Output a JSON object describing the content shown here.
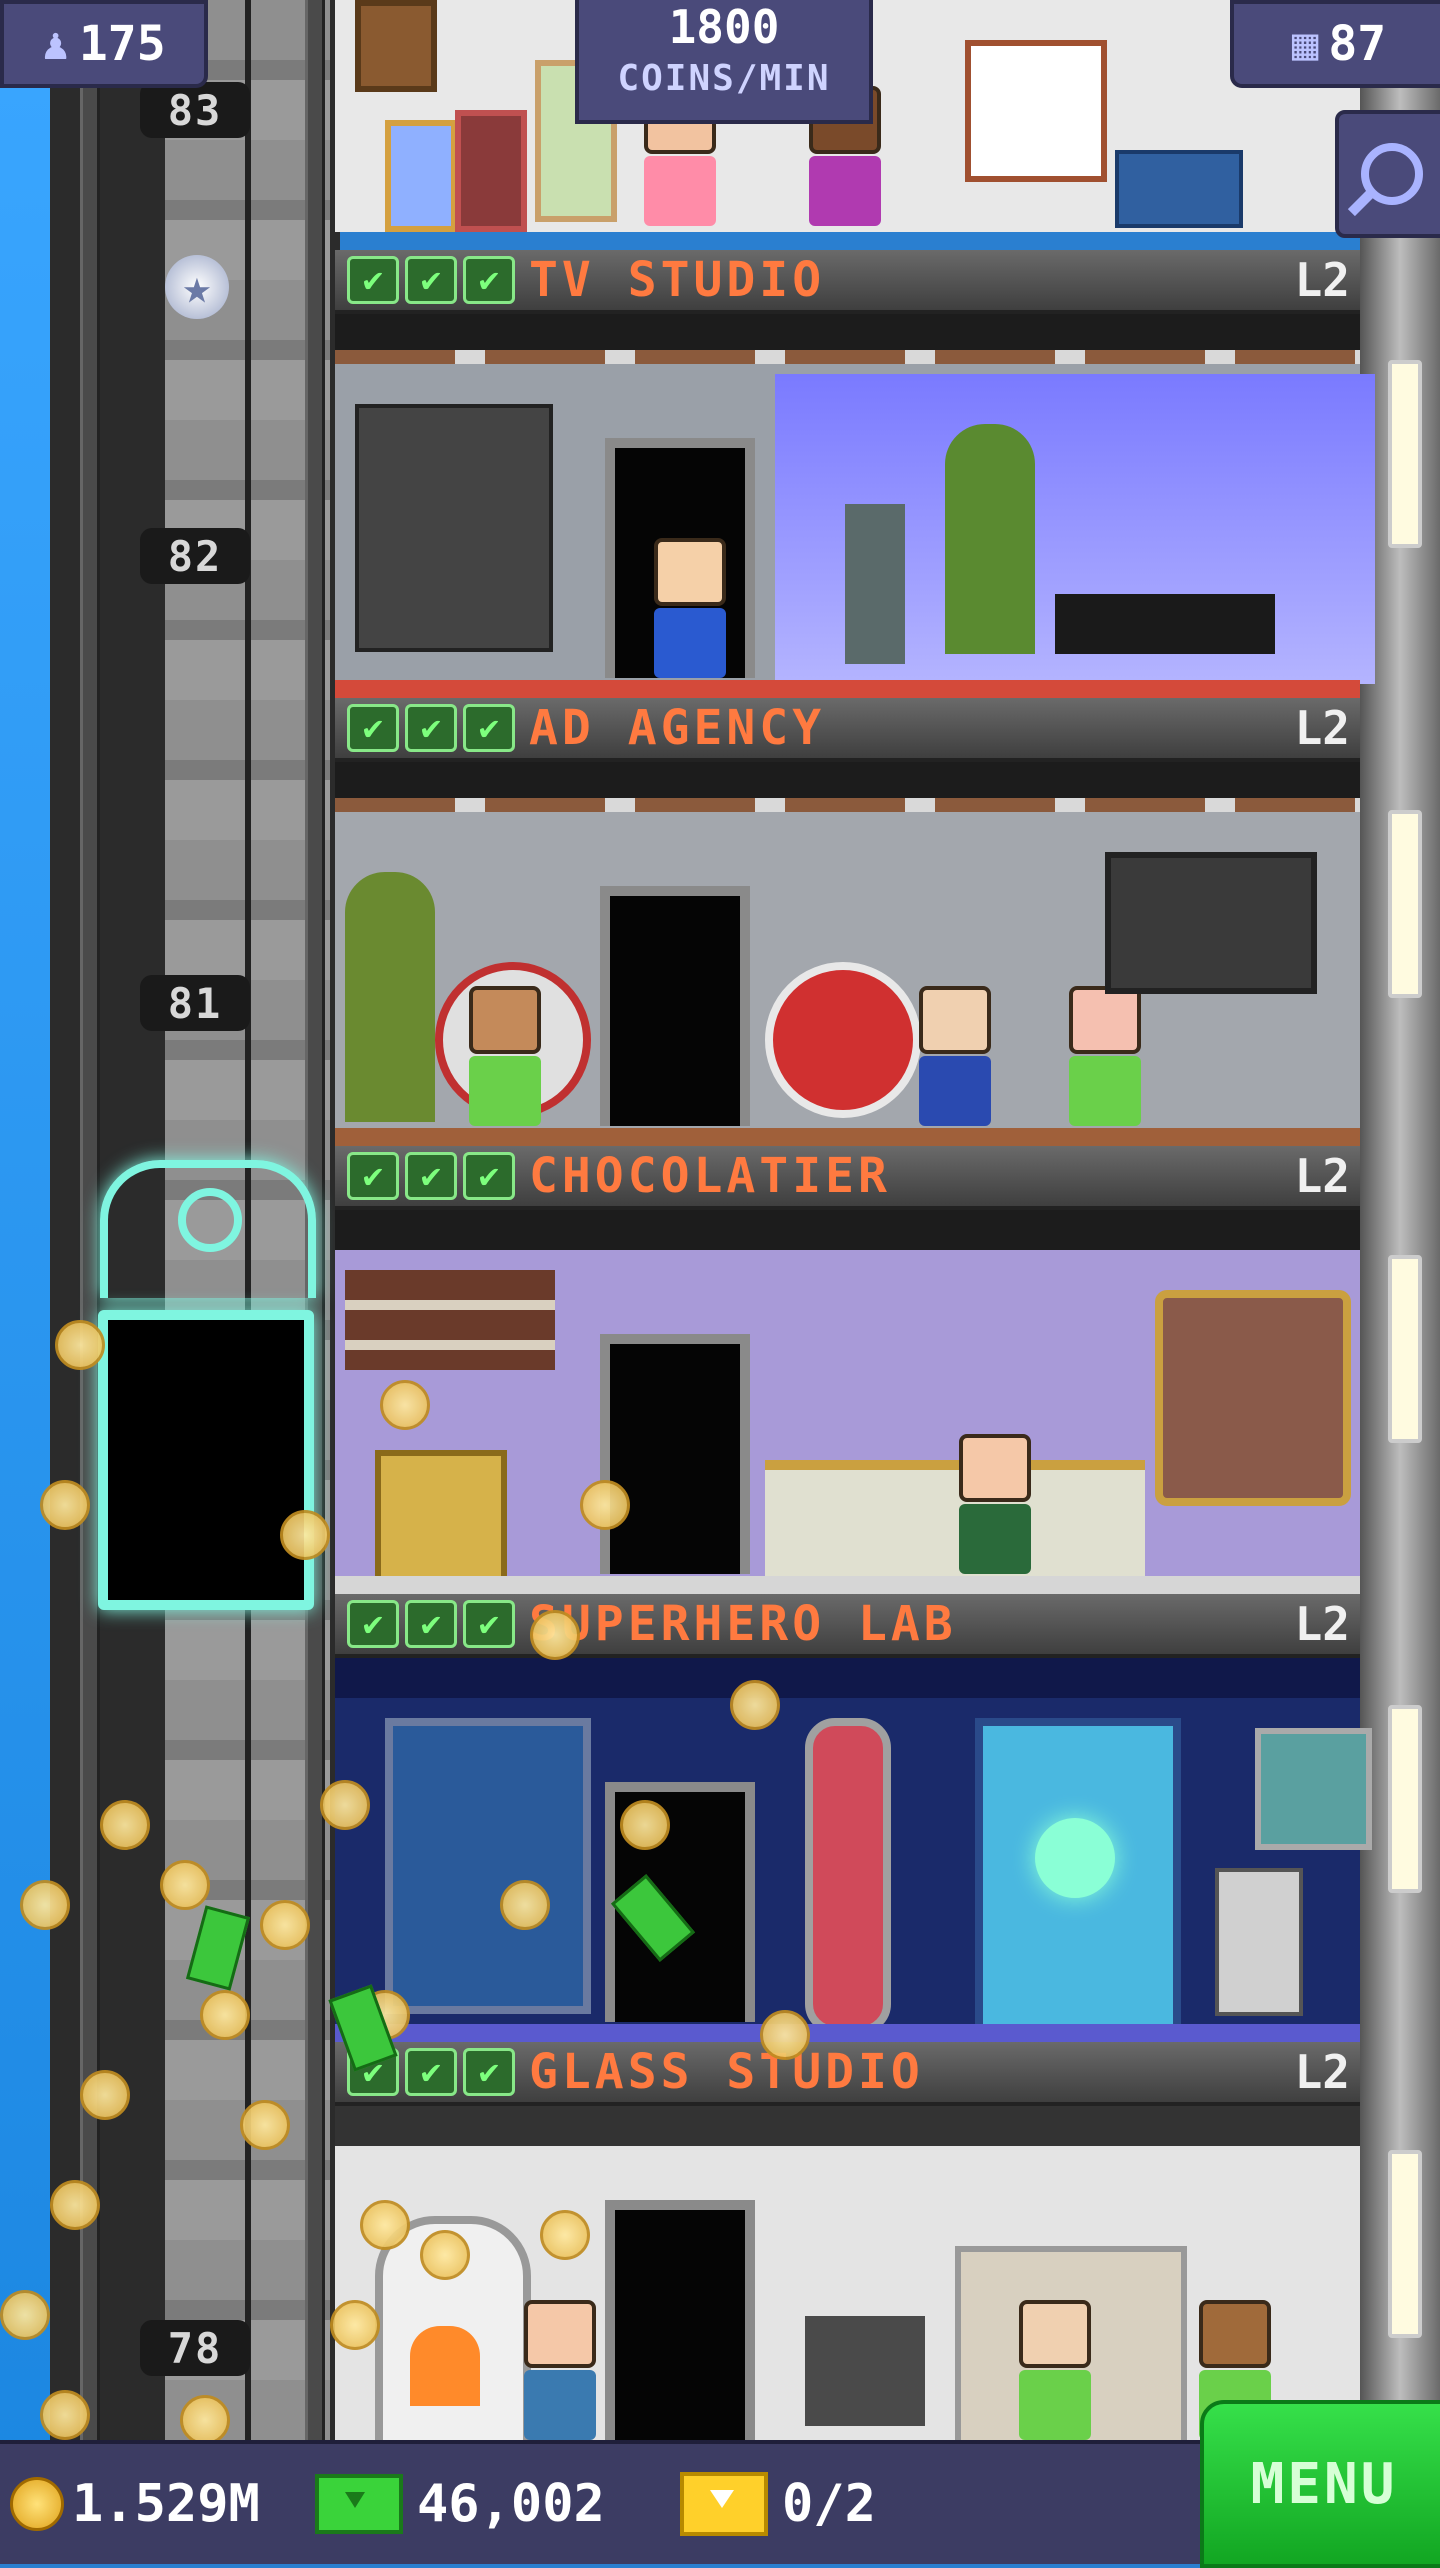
{
  "hud": {
    "population": "175",
    "coins_per_min_value": "1800",
    "coins_per_min_unit": "COINS/MIN",
    "floors": "87"
  },
  "elevator_shaft": {
    "floor_labels": [
      "83",
      "82",
      "81",
      "78"
    ]
  },
  "floors": [
    {
      "name": "TV STUDIO",
      "level": "L2",
      "checks": [
        "✔",
        "✔",
        "✔"
      ]
    },
    {
      "name": "AD AGENCY",
      "level": "L2",
      "checks": [
        "✔",
        "✔",
        "✔"
      ]
    },
    {
      "name": "CHOCOLATIER",
      "level": "L2",
      "checks": [
        "✔",
        "✔",
        "✔"
      ]
    },
    {
      "name": "SUPERHERO LAB",
      "level": "L2",
      "checks": [
        "✔",
        "✔",
        "✔"
      ]
    },
    {
      "name": "GLASS STUDIO",
      "level": "L2",
      "checks": [
        "✔",
        "✔",
        "✔"
      ]
    }
  ],
  "bottom_bar": {
    "coins": "1.529M",
    "bux": "46,002",
    "tickets": "0/2",
    "menu_label": "MENU"
  },
  "icons": {
    "population": "person-icon",
    "floors": "building-icon",
    "search": "magnifier-icon",
    "coin": "coin-icon",
    "bux": "bux-icon",
    "ticket": "ticket-icon",
    "vip": "star-icon"
  },
  "colors": {
    "floor_name": "#ff7a40",
    "check": "#7dff7d",
    "hud_bg": "#4a4a7a",
    "menu_bg": "#22c035",
    "elevator_glow": "#7ff5e0"
  }
}
